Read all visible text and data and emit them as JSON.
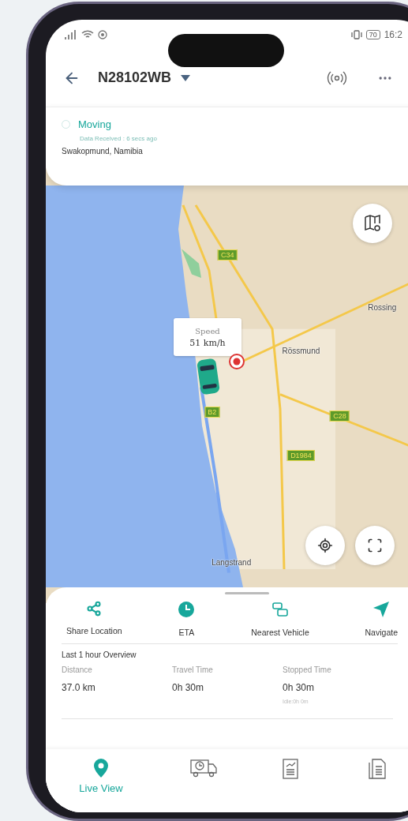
{
  "status_bar": {
    "battery": "70",
    "time": "16:2"
  },
  "header": {
    "title": "N28102WB"
  },
  "vehicle": {
    "status": "Moving",
    "received": "Data Received : 6 secs ago",
    "location": "Swakopmund, Namibia"
  },
  "map": {
    "speed_label": "Speed",
    "speed_value": "51 km/h",
    "labels": [
      {
        "text": "Rossing",
        "kind": "place"
      },
      {
        "text": "Rössmund",
        "kind": "place"
      },
      {
        "text": "Langstrand",
        "kind": "place"
      },
      {
        "text": "C34",
        "kind": "road"
      },
      {
        "text": "B2",
        "kind": "road"
      },
      {
        "text": "C28",
        "kind": "road"
      },
      {
        "text": "D1984",
        "kind": "road"
      }
    ]
  },
  "actions": [
    {
      "label": "Share Location",
      "kind": "share"
    },
    {
      "label": "ETA",
      "kind": "clock"
    },
    {
      "label": "Nearest Vehicle",
      "kind": "cars"
    },
    {
      "label": "Navigate",
      "kind": "navigate"
    }
  ],
  "overview": {
    "title": "Last 1 hour Overview",
    "stats": [
      {
        "label": "Distance",
        "value": "37.0 km"
      },
      {
        "label": "Travel Time",
        "value": "0h 30m"
      },
      {
        "label": "Stopped Time",
        "value": "0h 30m",
        "note": "Idle:0h 0m"
      }
    ]
  },
  "tabs": [
    {
      "kind": "live",
      "label": "Live View",
      "selected": true
    },
    {
      "kind": "trips",
      "selected": false
    },
    {
      "kind": "reports",
      "selected": false
    },
    {
      "kind": "documents",
      "selected": false
    }
  ]
}
